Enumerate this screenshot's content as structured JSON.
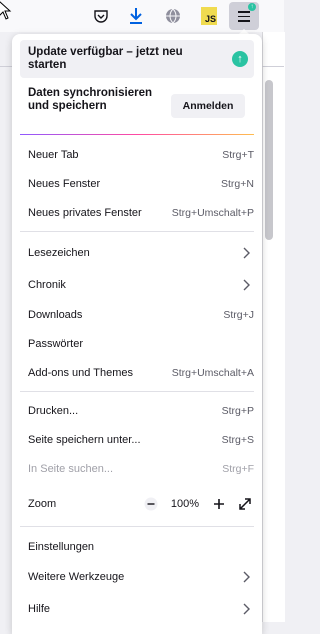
{
  "toolbar": {
    "icons": [
      "cursor-icon",
      "pocket-icon",
      "download-icon",
      "globe-icon",
      "js-extension-icon",
      "menu-icon"
    ],
    "js_badge": "JS"
  },
  "menu": {
    "update_banner": "Update verfügbar – jetzt neu starten",
    "sync_text": "Daten synchronisieren und speichern",
    "login_button": "Anmelden",
    "items": [
      {
        "label": "Neuer Tab",
        "shortcut": "Strg+T"
      },
      {
        "label": "Neues Fenster",
        "shortcut": "Strg+N"
      },
      {
        "label": "Neues privates Fenster",
        "shortcut": "Strg+Umschalt+P"
      },
      {
        "label": "Lesezeichen",
        "shortcut": ""
      },
      {
        "label": "Chronik",
        "shortcut": ""
      },
      {
        "label": "Downloads",
        "shortcut": "Strg+J"
      },
      {
        "label": "Passwörter",
        "shortcut": ""
      },
      {
        "label": "Add-ons und Themes",
        "shortcut": "Strg+Umschalt+A"
      },
      {
        "label": "Drucken...",
        "shortcut": "Strg+P"
      },
      {
        "label": "Seite speichern unter...",
        "shortcut": "Strg+S"
      },
      {
        "label": "In Seite suchen...",
        "shortcut": "Strg+F"
      },
      {
        "label": "Zoom",
        "shortcut": ""
      },
      {
        "label": "Einstellungen",
        "shortcut": ""
      },
      {
        "label": "Weitere Werkzeuge",
        "shortcut": ""
      },
      {
        "label": "Hilfe",
        "shortcut": ""
      }
    ],
    "zoom_value": "100%"
  },
  "colors": {
    "accent_green": "#2ac3a2",
    "download_blue": "#0061e0",
    "js_yellow": "#f0db4f"
  }
}
